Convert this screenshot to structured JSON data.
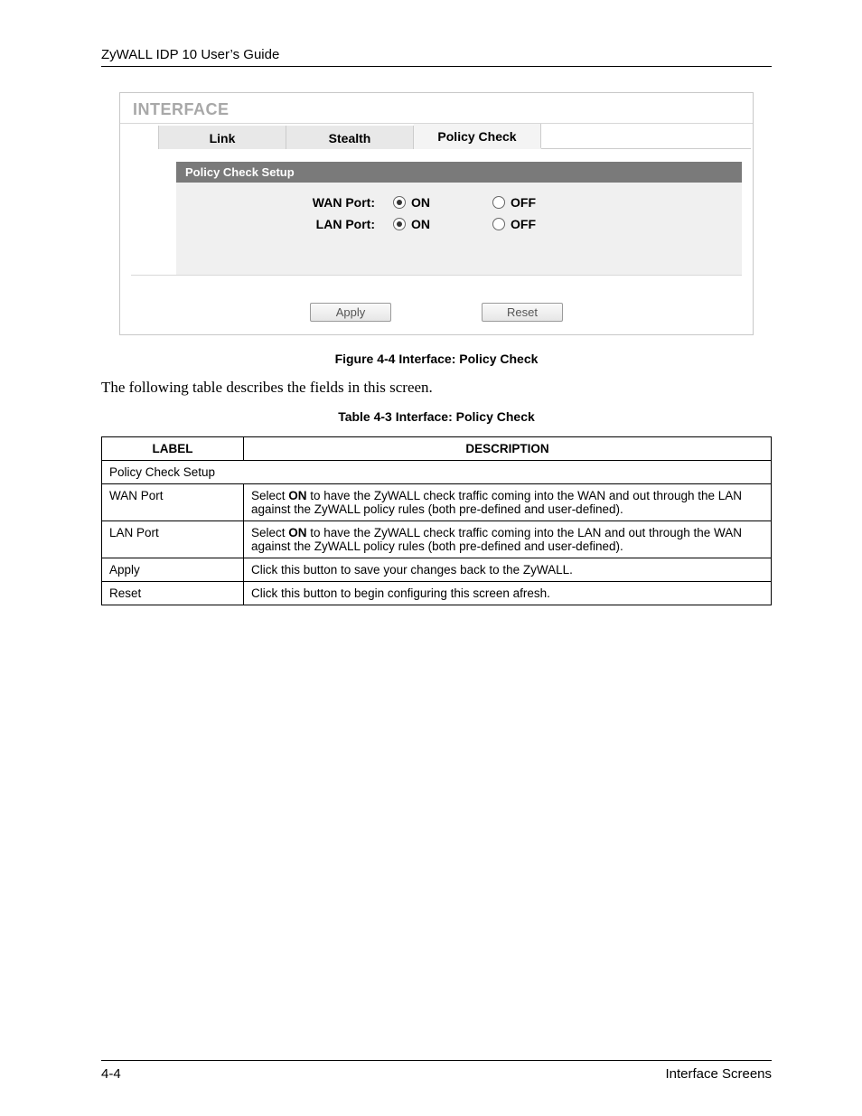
{
  "header": {
    "title": "ZyWALL IDP 10 User’s Guide"
  },
  "ui": {
    "panel_title": "INTERFACE",
    "tabs": [
      {
        "label": "Link",
        "active": false
      },
      {
        "label": "Stealth",
        "active": false
      },
      {
        "label": "Policy Check",
        "active": true
      }
    ],
    "section_title": "Policy Check Setup",
    "rows": [
      {
        "label": "WAN Port:",
        "on": "ON",
        "off": "OFF",
        "selected": "on"
      },
      {
        "label": "LAN Port:",
        "on": "ON",
        "off": "OFF",
        "selected": "on"
      }
    ],
    "buttons": {
      "apply": "Apply",
      "reset": "Reset"
    }
  },
  "figure_caption": "Figure 4-4 Interface: Policy Check",
  "intro_text": "The following table describes the fields in this screen.",
  "table_caption": "Table 4-3 Interface: Policy Check",
  "table": {
    "headers": {
      "label": "LABEL",
      "desc": "DESCRIPTION"
    },
    "section_row": "Policy Check Setup",
    "rows": [
      {
        "label": "WAN Port",
        "pre": "Select ",
        "bold": "ON",
        "post": " to have the ZyWALL check traffic coming into the WAN and out through the LAN against the ZyWALL policy rules (both pre-defined and user-defined)."
      },
      {
        "label": "LAN Port",
        "pre": "Select ",
        "bold": "ON",
        "post": " to have the ZyWALL check traffic coming into the LAN and out through the WAN against the ZyWALL policy rules (both pre-defined and user-defined)."
      },
      {
        "label": "Apply",
        "pre": "Click this button to save your changes back to the ZyWALL.",
        "bold": "",
        "post": ""
      },
      {
        "label": "Reset",
        "pre": "Click this button to begin configuring this screen afresh.",
        "bold": "",
        "post": ""
      }
    ]
  },
  "footer": {
    "page": "4-4",
    "section": "Interface Screens"
  }
}
